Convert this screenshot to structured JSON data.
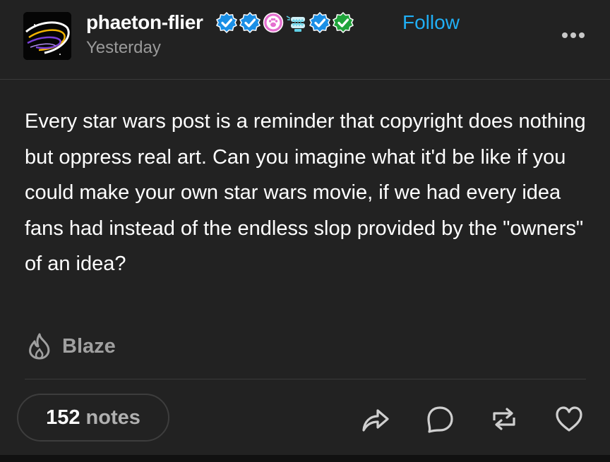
{
  "post": {
    "author": {
      "username": "phaeton-flier",
      "timestamp": "Yesterday",
      "avatar_icon": "orbit-swirl-avatar-icon",
      "badges": [
        {
          "icon": "verified-check-blue-icon",
          "color": "#1a8fe6"
        },
        {
          "icon": "verified-check-blue-icon",
          "color": "#1a8fe6"
        },
        {
          "icon": "paw-print-badge-icon",
          "color": "#e56fd0"
        },
        {
          "icon": "wind-up-teeth-badge-icon",
          "color": "#5fd2e8"
        },
        {
          "icon": "verified-check-blue-icon",
          "color": "#1a8fe6"
        },
        {
          "icon": "verified-check-green-icon",
          "color": "#1fa33a"
        }
      ],
      "follow_label": "Follow"
    },
    "more_icon": "more-dots-icon",
    "body_text": "Every star wars post is a reminder that copyright does nothing but oppress real art. Can you imagine what it'd be like if you could make your own star wars movie, if we had every idea fans had instead of the endless slop provided by the \"owners\" of an idea?",
    "blaze": {
      "icon": "flame-icon",
      "label": "Blaze"
    },
    "notes": {
      "count": "152",
      "label": "notes"
    },
    "actions": [
      {
        "name": "share",
        "icon": "share-arrow-icon"
      },
      {
        "name": "reply",
        "icon": "speech-bubble-icon"
      },
      {
        "name": "reblog",
        "icon": "reblog-icon"
      },
      {
        "name": "like",
        "icon": "heart-icon"
      }
    ]
  },
  "colors": {
    "background": "#222222",
    "text": "#ffffff",
    "muted": "#9a9a9a",
    "accent": "#20aff5"
  }
}
